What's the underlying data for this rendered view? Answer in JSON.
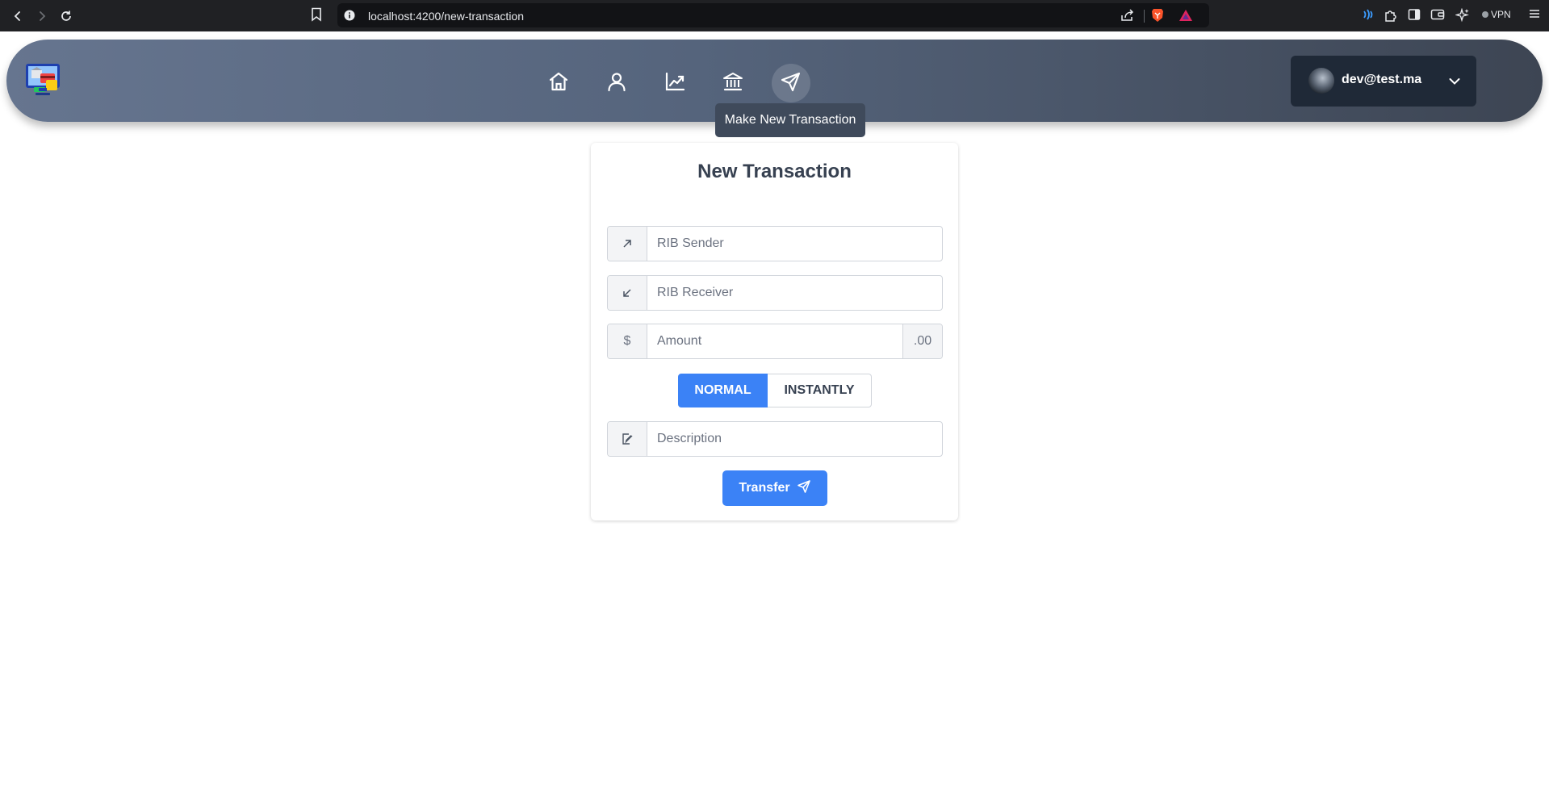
{
  "browser": {
    "url": "localhost:4200/new-transaction",
    "vpn_label": "VPN"
  },
  "navbar": {
    "items": [
      {
        "icon": "home-icon"
      },
      {
        "icon": "user-icon"
      },
      {
        "icon": "chart-line-icon"
      },
      {
        "icon": "bank-icon"
      },
      {
        "icon": "send-icon",
        "active": true
      }
    ],
    "tooltip": "Make New Transaction",
    "user_email": "dev@test.ma"
  },
  "form": {
    "title": "New Transaction",
    "rib_sender_placeholder": "RIB Sender",
    "rib_receiver_placeholder": "RIB Receiver",
    "amount_prefix": "$",
    "amount_placeholder": "Amount",
    "amount_suffix": ".00",
    "type_options": [
      "NORMAL",
      "INSTANTLY"
    ],
    "type_selected": "NORMAL",
    "description_placeholder": "Description",
    "submit_label": "Transfer"
  },
  "colors": {
    "accent": "#3b82f6",
    "navbar_gradient_start": "#66758f",
    "navbar_gradient_end": "#3d4553",
    "user_box": "#1f2937"
  }
}
